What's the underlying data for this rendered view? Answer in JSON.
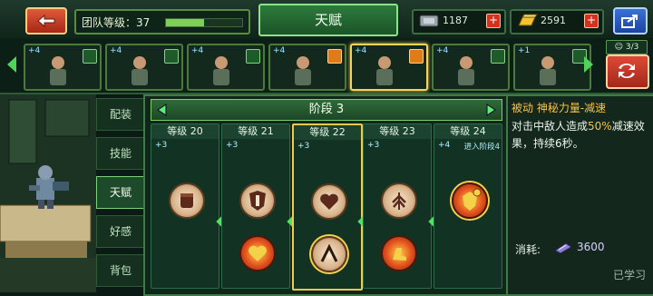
{
  "topbar": {
    "back_icon": "back-arrow-icon",
    "team_level_label": "团队等级：37",
    "team_level_progress": 0.5,
    "title": "天赋",
    "currencies": [
      {
        "icon": "cash-icon",
        "value": "1187"
      },
      {
        "icon": "gold-bar-icon",
        "value": "2591"
      }
    ],
    "share_icon": "share-icon"
  },
  "heroes": [
    {
      "star": "+4",
      "badge": "green",
      "selected": false
    },
    {
      "star": "+4",
      "badge": "green",
      "selected": false
    },
    {
      "star": "+4",
      "badge": "green",
      "selected": false
    },
    {
      "star": "+4",
      "badge": "orange",
      "selected": false
    },
    {
      "star": "+4",
      "badge": "orange",
      "selected": true
    },
    {
      "star": "+4",
      "badge": "green",
      "selected": false
    },
    {
      "star": "+1",
      "badge": "green",
      "selected": false
    }
  ],
  "team_count": "3/3",
  "side_tabs": [
    {
      "label": "配装",
      "active": false
    },
    {
      "label": "技能",
      "active": false
    },
    {
      "label": "天赋",
      "active": true
    },
    {
      "label": "好感",
      "active": false
    },
    {
      "label": "背包",
      "active": false
    }
  ],
  "talent": {
    "stage_title": "阶段 3",
    "tiers": [
      {
        "level": "等级 20",
        "plus": "+3",
        "extra": "",
        "current": false,
        "nodes": [
          "fist-icon"
        ]
      },
      {
        "level": "等级 21",
        "plus": "+3",
        "extra": "",
        "current": false,
        "nodes": [
          "shield-icon",
          "heart-fire-icon"
        ]
      },
      {
        "level": "等级 22",
        "plus": "+3",
        "extra": "",
        "current": true,
        "nodes": [
          "heart-icon",
          "mech-claw-icon"
        ]
      },
      {
        "level": "等级 23",
        "plus": "+3",
        "extra": "",
        "current": false,
        "nodes": [
          "tree-icon",
          "boot-fire-icon"
        ]
      },
      {
        "level": "等级 24",
        "plus": "+4",
        "extra": "进入阶段4",
        "current": false,
        "nodes": [
          "flame-shield-icon"
        ]
      }
    ]
  },
  "detail": {
    "name": "被动 神秘力量-减速",
    "desc_a": "对击中敌人造成",
    "desc_hl": "50%",
    "desc_b": "减速效果，持续6秒。",
    "cost_label": "消耗:",
    "cost_value": "3600",
    "cost_icon": "ticket-icon",
    "status": "已学习"
  }
}
